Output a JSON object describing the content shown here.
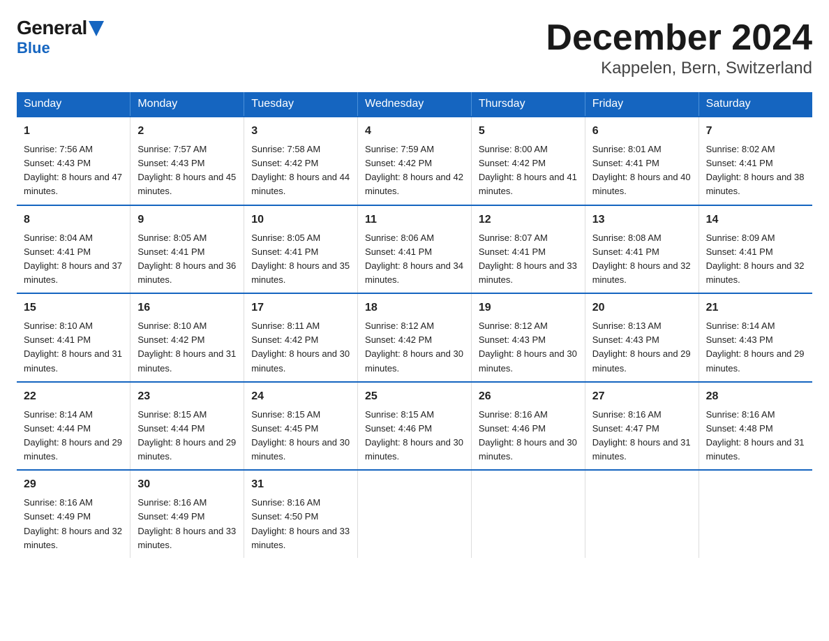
{
  "logo": {
    "general": "General",
    "blue": "Blue"
  },
  "header": {
    "month": "December 2024",
    "location": "Kappelen, Bern, Switzerland"
  },
  "days_of_week": [
    "Sunday",
    "Monday",
    "Tuesday",
    "Wednesday",
    "Thursday",
    "Friday",
    "Saturday"
  ],
  "weeks": [
    [
      {
        "day": "1",
        "sunrise": "7:56 AM",
        "sunset": "4:43 PM",
        "daylight": "8 hours and 47 minutes."
      },
      {
        "day": "2",
        "sunrise": "7:57 AM",
        "sunset": "4:43 PM",
        "daylight": "8 hours and 45 minutes."
      },
      {
        "day": "3",
        "sunrise": "7:58 AM",
        "sunset": "4:42 PM",
        "daylight": "8 hours and 44 minutes."
      },
      {
        "day": "4",
        "sunrise": "7:59 AM",
        "sunset": "4:42 PM",
        "daylight": "8 hours and 42 minutes."
      },
      {
        "day": "5",
        "sunrise": "8:00 AM",
        "sunset": "4:42 PM",
        "daylight": "8 hours and 41 minutes."
      },
      {
        "day": "6",
        "sunrise": "8:01 AM",
        "sunset": "4:41 PM",
        "daylight": "8 hours and 40 minutes."
      },
      {
        "day": "7",
        "sunrise": "8:02 AM",
        "sunset": "4:41 PM",
        "daylight": "8 hours and 38 minutes."
      }
    ],
    [
      {
        "day": "8",
        "sunrise": "8:04 AM",
        "sunset": "4:41 PM",
        "daylight": "8 hours and 37 minutes."
      },
      {
        "day": "9",
        "sunrise": "8:05 AM",
        "sunset": "4:41 PM",
        "daylight": "8 hours and 36 minutes."
      },
      {
        "day": "10",
        "sunrise": "8:05 AM",
        "sunset": "4:41 PM",
        "daylight": "8 hours and 35 minutes."
      },
      {
        "day": "11",
        "sunrise": "8:06 AM",
        "sunset": "4:41 PM",
        "daylight": "8 hours and 34 minutes."
      },
      {
        "day": "12",
        "sunrise": "8:07 AM",
        "sunset": "4:41 PM",
        "daylight": "8 hours and 33 minutes."
      },
      {
        "day": "13",
        "sunrise": "8:08 AM",
        "sunset": "4:41 PM",
        "daylight": "8 hours and 32 minutes."
      },
      {
        "day": "14",
        "sunrise": "8:09 AM",
        "sunset": "4:41 PM",
        "daylight": "8 hours and 32 minutes."
      }
    ],
    [
      {
        "day": "15",
        "sunrise": "8:10 AM",
        "sunset": "4:41 PM",
        "daylight": "8 hours and 31 minutes."
      },
      {
        "day": "16",
        "sunrise": "8:10 AM",
        "sunset": "4:42 PM",
        "daylight": "8 hours and 31 minutes."
      },
      {
        "day": "17",
        "sunrise": "8:11 AM",
        "sunset": "4:42 PM",
        "daylight": "8 hours and 30 minutes."
      },
      {
        "day": "18",
        "sunrise": "8:12 AM",
        "sunset": "4:42 PM",
        "daylight": "8 hours and 30 minutes."
      },
      {
        "day": "19",
        "sunrise": "8:12 AM",
        "sunset": "4:43 PM",
        "daylight": "8 hours and 30 minutes."
      },
      {
        "day": "20",
        "sunrise": "8:13 AM",
        "sunset": "4:43 PM",
        "daylight": "8 hours and 29 minutes."
      },
      {
        "day": "21",
        "sunrise": "8:14 AM",
        "sunset": "4:43 PM",
        "daylight": "8 hours and 29 minutes."
      }
    ],
    [
      {
        "day": "22",
        "sunrise": "8:14 AM",
        "sunset": "4:44 PM",
        "daylight": "8 hours and 29 minutes."
      },
      {
        "day": "23",
        "sunrise": "8:15 AM",
        "sunset": "4:44 PM",
        "daylight": "8 hours and 29 minutes."
      },
      {
        "day": "24",
        "sunrise": "8:15 AM",
        "sunset": "4:45 PM",
        "daylight": "8 hours and 30 minutes."
      },
      {
        "day": "25",
        "sunrise": "8:15 AM",
        "sunset": "4:46 PM",
        "daylight": "8 hours and 30 minutes."
      },
      {
        "day": "26",
        "sunrise": "8:16 AM",
        "sunset": "4:46 PM",
        "daylight": "8 hours and 30 minutes."
      },
      {
        "day": "27",
        "sunrise": "8:16 AM",
        "sunset": "4:47 PM",
        "daylight": "8 hours and 31 minutes."
      },
      {
        "day": "28",
        "sunrise": "8:16 AM",
        "sunset": "4:48 PM",
        "daylight": "8 hours and 31 minutes."
      }
    ],
    [
      {
        "day": "29",
        "sunrise": "8:16 AM",
        "sunset": "4:49 PM",
        "daylight": "8 hours and 32 minutes."
      },
      {
        "day": "30",
        "sunrise": "8:16 AM",
        "sunset": "4:49 PM",
        "daylight": "8 hours and 33 minutes."
      },
      {
        "day": "31",
        "sunrise": "8:16 AM",
        "sunset": "4:50 PM",
        "daylight": "8 hours and 33 minutes."
      },
      null,
      null,
      null,
      null
    ]
  ]
}
